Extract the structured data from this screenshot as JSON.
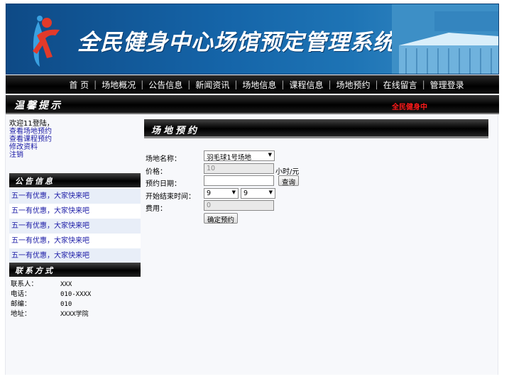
{
  "banner": {
    "title": "全民健身中心场馆预定管理系统"
  },
  "nav": {
    "items": [
      "首 页",
      "场地概况",
      "公告信息",
      "新闻资讯",
      "场地信息",
      "课程信息",
      "场地预约",
      "在线留言",
      "管理登录"
    ]
  },
  "tips": {
    "title": "温馨提示",
    "marquee": "全民健身中"
  },
  "user": {
    "welcome": "欢迎11登陆，",
    "links": [
      "查看场地预约",
      "查看课程预约",
      "修改资料",
      "注销"
    ]
  },
  "notices": {
    "title": "公告信息",
    "items": [
      "五一有优惠，大家快来吧",
      "五一有优惠，大家快来吧",
      "五一有优惠，大家快来吧",
      "五一有优惠，大家快来吧",
      "五一有优惠，大家快来吧"
    ]
  },
  "contact": {
    "title": "联系方式",
    "rows": [
      {
        "label": "联系人：",
        "value": "XXX"
      },
      {
        "label": "电话：",
        "value": "010-XXXX"
      },
      {
        "label": "邮编：",
        "value": "010"
      },
      {
        "label": "地址：",
        "value": "XXXX学院"
      }
    ]
  },
  "booking": {
    "title": "场地预约",
    "venue_label": "场地名称：",
    "venue_value": "羽毛球1号场地",
    "price_label": "价格：",
    "price_value": "10",
    "price_unit": "小时/元",
    "date_label": "预约日期：",
    "date_value": "",
    "query_button": "查询",
    "time_label": "开始结束时间：",
    "start_value": "9",
    "end_value": "9",
    "fee_label": "费用：",
    "fee_value": "0",
    "submit_button": "确定预约"
  }
}
